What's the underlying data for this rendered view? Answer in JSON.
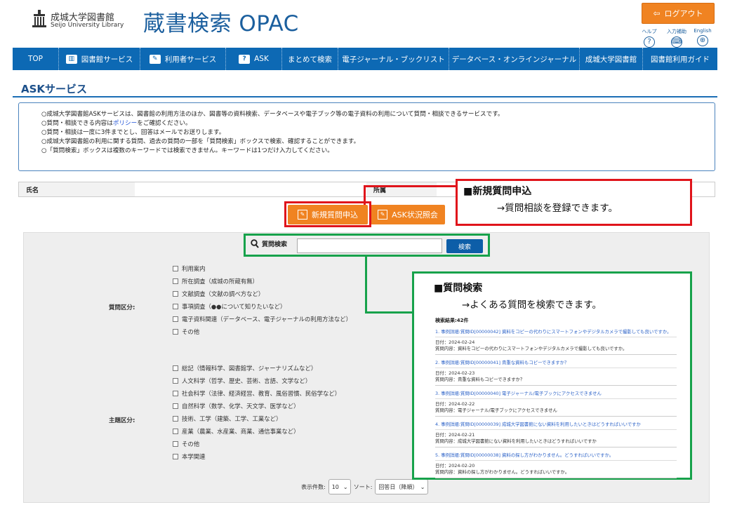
{
  "header": {
    "logo_ja": "成城大学図書館",
    "logo_en": "Seijo University Library",
    "title": "蔵書検索 OPAC",
    "logout_label": "ログアウト",
    "help_label": "ヘルプ",
    "input_assist_label": "入力補助",
    "english_label": "English"
  },
  "nav": {
    "items": [
      {
        "label": "TOP"
      },
      {
        "label": "図書館サービス"
      },
      {
        "label": "利用者サービス"
      },
      {
        "label": "ASK"
      },
      {
        "label": "まとめて検索"
      },
      {
        "label": "電子ジャーナル・ブックリスト"
      },
      {
        "label": "データベース・オンラインジャーナル"
      },
      {
        "label": "成城大学図書館"
      },
      {
        "label": "図書館利用ガイド"
      }
    ]
  },
  "section": {
    "title": "ASKサービス",
    "info_lines": [
      "○成城大学図書館ASKサービスは、図書館の利用方法のほか、図書等の資料検索、データベースや電子ブック等の電子資料の利用について質問・相談できるサービスです。",
      "○質問・相談できる内容は",
      "○質問・相談は一度に3件までとし、回答はメールでお送りします。",
      "○成城大学図書館の利用に関する質問、過去の質問の一部を「質問検索」ボックスで検索、確認することができます。",
      "○「質問検索」ボックスは複数のキーワードでは検索できません。キーワードは1つだけ入力してください。"
    ],
    "policy_link": "ポリシー",
    "policy_suffix": "をご確認ください。"
  },
  "user_row": {
    "name_label": "氏名",
    "affiliation_label": "所属"
  },
  "buttons": {
    "new_question": "新規質問申込",
    "status_inquiry": "ASK状況照会"
  },
  "search": {
    "label": "質問検索",
    "value": "",
    "button": "検索"
  },
  "question_category": {
    "label": "質問区分:",
    "options": [
      "利用案内",
      "所在調査（成城の所蔵有無）",
      "文献調査（文献の調べ方など）",
      "事項調査（●●について知りたいなど）",
      "電子資料関連（データベース、電子ジャーナルの利用方法など）",
      "その他"
    ]
  },
  "subject_category": {
    "label": "主題区分:",
    "options": [
      "総記（情報科学、図書館学、ジャーナリズムなど）",
      "人文科学（哲学、歴史、芸術、言語、文学など）",
      "社会科学（法律、経済経営、教育、風俗習慣、民俗学など）",
      "自然科学（数学、化学、天文学、医学など）",
      "技術、工学（建築、工学、工業など）",
      "産業（農業、水産業、商業、通信事業など）",
      "その他",
      "本学関連"
    ]
  },
  "bottom": {
    "count_label": "表示件数:",
    "count_value": "10",
    "sort_label": "ソート:",
    "sort_value": "回答日（降順）"
  },
  "callout_new": {
    "heading": "■新規質問申込",
    "body": "→質問相談を登録できます。"
  },
  "callout_search": {
    "heading": "■質問検索",
    "body": "→よくある質問を検索できます。",
    "results_count": "検索結果:42件",
    "results": [
      {
        "title": "1. 事例詳細:質問ID[00000042] 資料をコピーの代わりにスマートフォンやデジタルカメラで撮影しても良いですか。",
        "date": "日付：2024-02-24",
        "content": "質問内容：資料をコピーの代わりにスマートフォンやデジタルカメラで撮影しても良いですか。"
      },
      {
        "title": "2. 事例詳細:質問ID[00000041] 貴重な資料もコピーできますか？",
        "date": "日付：2024-02-23",
        "content": "質問内容：貴重な資料もコピーできますか？"
      },
      {
        "title": "3. 事例詳細:質問ID[00000040] 電子ジャーナル/電子ブックにアクセスできません",
        "date": "日付：2024-02-22",
        "content": "質問内容：電子ジャーナル/電子ブックにアクセスできません"
      },
      {
        "title": "4. 事例詳細:質問ID[00000039] 成城大学図書館にない資料を利用したいときはどうすればいいですか",
        "date": "日付：2024-02-21",
        "content": "質問内容：成城大学図書館にない資料を利用したいときはどうすればいいですか"
      },
      {
        "title": "5. 事例詳細:質問ID[00000038] 資料の探し方がわかりません。どうすればいいですか。",
        "date": "日付：2024-02-20",
        "content": "質問内容：資料の探し方がわかりません。どうすればいいですか。"
      }
    ]
  },
  "colors": {
    "brand_blue": "#0d69b4",
    "accent_orange": "#f08321",
    "callout_red": "#e0141b",
    "callout_green": "#17a24b"
  }
}
